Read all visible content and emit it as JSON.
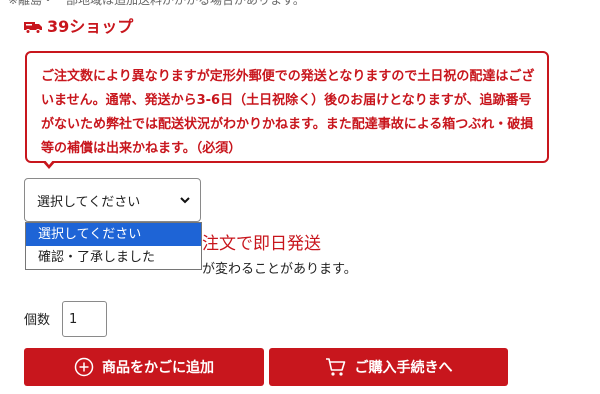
{
  "top_cut_text": "※離島・一部地域は追加送料がかかる場合があります。",
  "shop": {
    "icon": "truck-icon",
    "name": "39ショップ"
  },
  "notice": {
    "text": "ご注文数により異なりますが定形外郵便での発送となりますので土日祝の配達はございません。通常、発送から3-6日（土日祝除く）後のお届けとなりますが、追跡番号がないため弊社では配送状況がわかりかねます。また配達事故による箱つぶれ・破損等の補償は出来かねます。（必須）"
  },
  "select": {
    "value": "選択してください",
    "options": [
      {
        "label": "選択してください",
        "selected": true
      },
      {
        "label": "確認・了承しました",
        "selected": false
      }
    ]
  },
  "behind_text": {
    "red": "注文で即日発送",
    "black": "が変わることがあります。"
  },
  "quantity": {
    "label": "個数",
    "value": "1"
  },
  "buttons": {
    "add_to_cart": "商品をかごに追加",
    "checkout": "ご購入手続きへ"
  },
  "colors": {
    "accent_red": "#c8161d",
    "selected_blue": "#1e64d6"
  }
}
